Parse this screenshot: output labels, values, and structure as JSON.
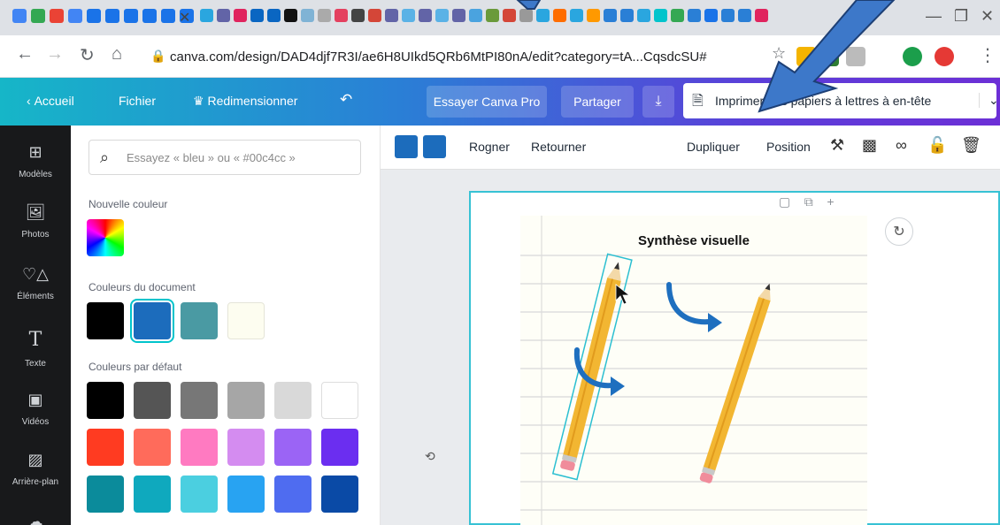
{
  "browser": {
    "url": "canva.com/design/DAD4djf7R3I/ae6H8UIkd5QRb6MtPI80nA/edit?category=tA...CqsdcSU#",
    "favicon_colors_left": [
      "#4285f4",
      "#34a853",
      "#ea4335",
      "#4285f4",
      "#1a73e8",
      "#1a73e8",
      "#1a73e8",
      "#1a73e8",
      "#1a73e8",
      "#1a73e8"
    ],
    "favicon_colors_right": [
      "#2aa6df",
      "#6264a7",
      "#e0245e",
      "#0a66c2",
      "#0a66c2",
      "#111111",
      "#7fb3d5",
      "#aaaaaa",
      "#e4405f",
      "#444444",
      "#d44638",
      "#6264a7",
      "#5ab2e6",
      "#6264a7",
      "#5ab2e6",
      "#6264a7",
      "#4aa3df",
      "#6a9a3b",
      "#d44638",
      "#999999",
      "#2aa6df",
      "#ff6d00",
      "#2aa6df",
      "#ff9900",
      "#2a7fd6",
      "#2a7fd6",
      "#2aa6df",
      "#00c4cc",
      "#34a853",
      "#2a7fd6",
      "#1a73e8",
      "#2a7fd6",
      "#2a7fd6",
      "#e0245e",
      "#d44638",
      "#7b1fa2"
    ]
  },
  "header": {
    "back_label": "Accueil",
    "file_label": "Fichier",
    "resize_label": "Redimensionner",
    "undo_icon": "undo-icon",
    "try_pro_label": "Essayer Canva Pro",
    "share_label": "Partager",
    "download_icon": "download-icon",
    "print_label": "Imprimer des papiers à lettres à en-tête"
  },
  "sidebar": {
    "items": [
      {
        "label": "Modèles",
        "icon": "layout-icon"
      },
      {
        "label": "Photos",
        "icon": "image-icon"
      },
      {
        "label": "Éléments",
        "icon": "shapes-icon"
      },
      {
        "label": "Texte",
        "icon": "text-icon"
      },
      {
        "label": "Vidéos",
        "icon": "video-icon"
      },
      {
        "label": "Arrière-plan",
        "icon": "pattern-icon"
      }
    ]
  },
  "panel": {
    "search_placeholder": "Essayez « bleu » ou « #00c4cc »",
    "new_color_label": "Nouvelle couleur",
    "document_colors_label": "Couleurs du document",
    "default_colors_label": "Couleurs par défaut",
    "document_colors": [
      "#000000",
      "#1c6cbc",
      "#4a9aa3",
      "#fdfdf0"
    ],
    "default_colors": [
      [
        "#000000",
        "#555555",
        "#777777",
        "#a6a6a6",
        "#d9d9d9",
        "#ffffff"
      ],
      [
        "#ff3b21",
        "#ff6b5b",
        "#ff7ac1",
        "#d48cf0",
        "#9b64f5",
        "#6b2ef0"
      ],
      [
        "#0b8b9b",
        "#0fa9be",
        "#4bcfe0",
        "#28a3f2",
        "#4f6cf0",
        "#0a4aa6"
      ]
    ]
  },
  "toolbar": {
    "crop_label": "Rogner",
    "flip_label": "Retourner",
    "duplicate_label": "Dupliquer",
    "position_label": "Position"
  },
  "canvas": {
    "title": "Synthèse visuelle"
  },
  "colors": {
    "accent": "#00c4cc",
    "selected_blue": "#1c6cbc",
    "arrow_blue": "#1e6fbf"
  }
}
